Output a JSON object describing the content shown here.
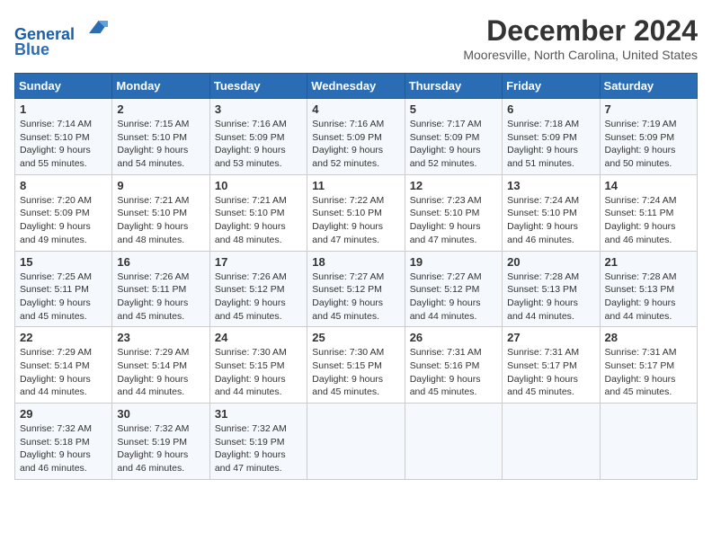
{
  "header": {
    "logo_line1": "General",
    "logo_line2": "Blue",
    "month": "December 2024",
    "location": "Mooresville, North Carolina, United States"
  },
  "days_of_week": [
    "Sunday",
    "Monday",
    "Tuesday",
    "Wednesday",
    "Thursday",
    "Friday",
    "Saturday"
  ],
  "weeks": [
    [
      {
        "day": "1",
        "sunrise": "Sunrise: 7:14 AM",
        "sunset": "Sunset: 5:10 PM",
        "daylight": "Daylight: 9 hours and 55 minutes."
      },
      {
        "day": "2",
        "sunrise": "Sunrise: 7:15 AM",
        "sunset": "Sunset: 5:10 PM",
        "daylight": "Daylight: 9 hours and 54 minutes."
      },
      {
        "day": "3",
        "sunrise": "Sunrise: 7:16 AM",
        "sunset": "Sunset: 5:09 PM",
        "daylight": "Daylight: 9 hours and 53 minutes."
      },
      {
        "day": "4",
        "sunrise": "Sunrise: 7:16 AM",
        "sunset": "Sunset: 5:09 PM",
        "daylight": "Daylight: 9 hours and 52 minutes."
      },
      {
        "day": "5",
        "sunrise": "Sunrise: 7:17 AM",
        "sunset": "Sunset: 5:09 PM",
        "daylight": "Daylight: 9 hours and 52 minutes."
      },
      {
        "day": "6",
        "sunrise": "Sunrise: 7:18 AM",
        "sunset": "Sunset: 5:09 PM",
        "daylight": "Daylight: 9 hours and 51 minutes."
      },
      {
        "day": "7",
        "sunrise": "Sunrise: 7:19 AM",
        "sunset": "Sunset: 5:09 PM",
        "daylight": "Daylight: 9 hours and 50 minutes."
      }
    ],
    [
      {
        "day": "8",
        "sunrise": "Sunrise: 7:20 AM",
        "sunset": "Sunset: 5:09 PM",
        "daylight": "Daylight: 9 hours and 49 minutes."
      },
      {
        "day": "9",
        "sunrise": "Sunrise: 7:21 AM",
        "sunset": "Sunset: 5:10 PM",
        "daylight": "Daylight: 9 hours and 48 minutes."
      },
      {
        "day": "10",
        "sunrise": "Sunrise: 7:21 AM",
        "sunset": "Sunset: 5:10 PM",
        "daylight": "Daylight: 9 hours and 48 minutes."
      },
      {
        "day": "11",
        "sunrise": "Sunrise: 7:22 AM",
        "sunset": "Sunset: 5:10 PM",
        "daylight": "Daylight: 9 hours and 47 minutes."
      },
      {
        "day": "12",
        "sunrise": "Sunrise: 7:23 AM",
        "sunset": "Sunset: 5:10 PM",
        "daylight": "Daylight: 9 hours and 47 minutes."
      },
      {
        "day": "13",
        "sunrise": "Sunrise: 7:24 AM",
        "sunset": "Sunset: 5:10 PM",
        "daylight": "Daylight: 9 hours and 46 minutes."
      },
      {
        "day": "14",
        "sunrise": "Sunrise: 7:24 AM",
        "sunset": "Sunset: 5:11 PM",
        "daylight": "Daylight: 9 hours and 46 minutes."
      }
    ],
    [
      {
        "day": "15",
        "sunrise": "Sunrise: 7:25 AM",
        "sunset": "Sunset: 5:11 PM",
        "daylight": "Daylight: 9 hours and 45 minutes."
      },
      {
        "day": "16",
        "sunrise": "Sunrise: 7:26 AM",
        "sunset": "Sunset: 5:11 PM",
        "daylight": "Daylight: 9 hours and 45 minutes."
      },
      {
        "day": "17",
        "sunrise": "Sunrise: 7:26 AM",
        "sunset": "Sunset: 5:12 PM",
        "daylight": "Daylight: 9 hours and 45 minutes."
      },
      {
        "day": "18",
        "sunrise": "Sunrise: 7:27 AM",
        "sunset": "Sunset: 5:12 PM",
        "daylight": "Daylight: 9 hours and 45 minutes."
      },
      {
        "day": "19",
        "sunrise": "Sunrise: 7:27 AM",
        "sunset": "Sunset: 5:12 PM",
        "daylight": "Daylight: 9 hours and 44 minutes."
      },
      {
        "day": "20",
        "sunrise": "Sunrise: 7:28 AM",
        "sunset": "Sunset: 5:13 PM",
        "daylight": "Daylight: 9 hours and 44 minutes."
      },
      {
        "day": "21",
        "sunrise": "Sunrise: 7:28 AM",
        "sunset": "Sunset: 5:13 PM",
        "daylight": "Daylight: 9 hours and 44 minutes."
      }
    ],
    [
      {
        "day": "22",
        "sunrise": "Sunrise: 7:29 AM",
        "sunset": "Sunset: 5:14 PM",
        "daylight": "Daylight: 9 hours and 44 minutes."
      },
      {
        "day": "23",
        "sunrise": "Sunrise: 7:29 AM",
        "sunset": "Sunset: 5:14 PM",
        "daylight": "Daylight: 9 hours and 44 minutes."
      },
      {
        "day": "24",
        "sunrise": "Sunrise: 7:30 AM",
        "sunset": "Sunset: 5:15 PM",
        "daylight": "Daylight: 9 hours and 44 minutes."
      },
      {
        "day": "25",
        "sunrise": "Sunrise: 7:30 AM",
        "sunset": "Sunset: 5:15 PM",
        "daylight": "Daylight: 9 hours and 45 minutes."
      },
      {
        "day": "26",
        "sunrise": "Sunrise: 7:31 AM",
        "sunset": "Sunset: 5:16 PM",
        "daylight": "Daylight: 9 hours and 45 minutes."
      },
      {
        "day": "27",
        "sunrise": "Sunrise: 7:31 AM",
        "sunset": "Sunset: 5:17 PM",
        "daylight": "Daylight: 9 hours and 45 minutes."
      },
      {
        "day": "28",
        "sunrise": "Sunrise: 7:31 AM",
        "sunset": "Sunset: 5:17 PM",
        "daylight": "Daylight: 9 hours and 45 minutes."
      }
    ],
    [
      {
        "day": "29",
        "sunrise": "Sunrise: 7:32 AM",
        "sunset": "Sunset: 5:18 PM",
        "daylight": "Daylight: 9 hours and 46 minutes."
      },
      {
        "day": "30",
        "sunrise": "Sunrise: 7:32 AM",
        "sunset": "Sunset: 5:19 PM",
        "daylight": "Daylight: 9 hours and 46 minutes."
      },
      {
        "day": "31",
        "sunrise": "Sunrise: 7:32 AM",
        "sunset": "Sunset: 5:19 PM",
        "daylight": "Daylight: 9 hours and 47 minutes."
      },
      null,
      null,
      null,
      null
    ]
  ]
}
